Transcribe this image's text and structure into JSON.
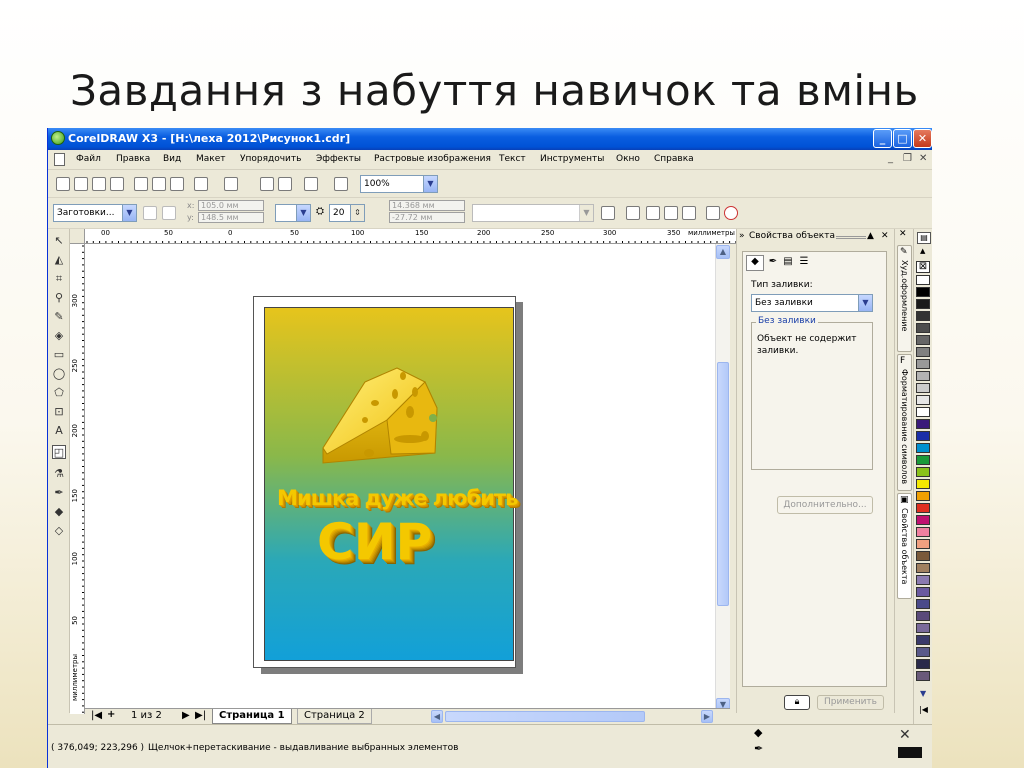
{
  "slide": {
    "title": "Завдання з набуття навичок та вмінь"
  },
  "window": {
    "title": "CorelDRAW X3 - [H:\\леха 2012\\Рисунок1.cdr]",
    "controls": {
      "minimize": "_",
      "maximize": "□",
      "close": "✕"
    }
  },
  "menu": {
    "items": [
      "Файл",
      "Правка",
      "Вид",
      "Макет",
      "Упорядочить",
      "Эффекты",
      "Растровые изображения",
      "Текст",
      "Инструменты",
      "Окно",
      "Справка"
    ],
    "mdi": {
      "min": "_",
      "restore": "❐",
      "close": "✕"
    }
  },
  "standard_toolbar": {
    "zoom": "100%"
  },
  "property_bar": {
    "presets": "Заготовки...",
    "x_label": "x:",
    "x_value": "105.0 мм",
    "y_label": "y:",
    "y_value": "148.5 мм",
    "depth": "20",
    "vp_x": "14.368 мм",
    "vp_y": "-27.72 мм"
  },
  "ruler": {
    "h_labels": [
      "00",
      "50",
      "0",
      "50",
      "100",
      "150",
      "200",
      "250",
      "300",
      "350"
    ],
    "unit": "миллиметры",
    "v_labels": [
      "300",
      "250",
      "200",
      "150",
      "100",
      "50"
    ],
    "v_unit": "миллиметры"
  },
  "artwork": {
    "line1": "Мишка дуже любить",
    "line2": "СИР"
  },
  "pages": {
    "counter": "1 из 2",
    "tabs": [
      "Страница 1",
      "Страница 2"
    ],
    "nav": {
      "first": "|◀",
      "add": "+",
      "prev": "▶",
      "next": "▶|"
    }
  },
  "status": {
    "coords": "( 376,049; 223,296 )",
    "message": "Щелчок+перетаскивание - выдавливание выбранных элементов"
  },
  "docker": {
    "title": "Свойства объекта",
    "fill_type_label": "Тип заливки:",
    "fill_type_value": "Без заливки",
    "group_title": "Без заливки",
    "group_text": "Объект не содержит заливки.",
    "more_button": "Дополнительно...",
    "apply_button": "Применить",
    "vertical_tabs": [
      "Худ.оформление",
      "Форматирование символов",
      "Свойства объекта"
    ]
  },
  "palette": {
    "colors": [
      "#ffffff",
      "#000000",
      "#1a1a1a",
      "#333333",
      "#4d4d4d",
      "#666666",
      "#808080",
      "#999999",
      "#b3b3b3",
      "#cccccc",
      "#e6e6e6",
      "#ffffff",
      "#3a1a7a",
      "#1a2ea8",
      "#0090d0",
      "#1a9a3a",
      "#8ac21a",
      "#f4e800",
      "#f0a000",
      "#e03020",
      "#c01070",
      "#f080a0",
      "#f0a080",
      "#7a5a3a",
      "#a08060",
      "#8a7ab0",
      "#6a5aa0",
      "#4a4a8a",
      "#5a4a7a",
      "#7a6a9a",
      "#3a3a6a",
      "#5a5a8a",
      "#2a2a4a",
      "#6a5a7a"
    ]
  }
}
